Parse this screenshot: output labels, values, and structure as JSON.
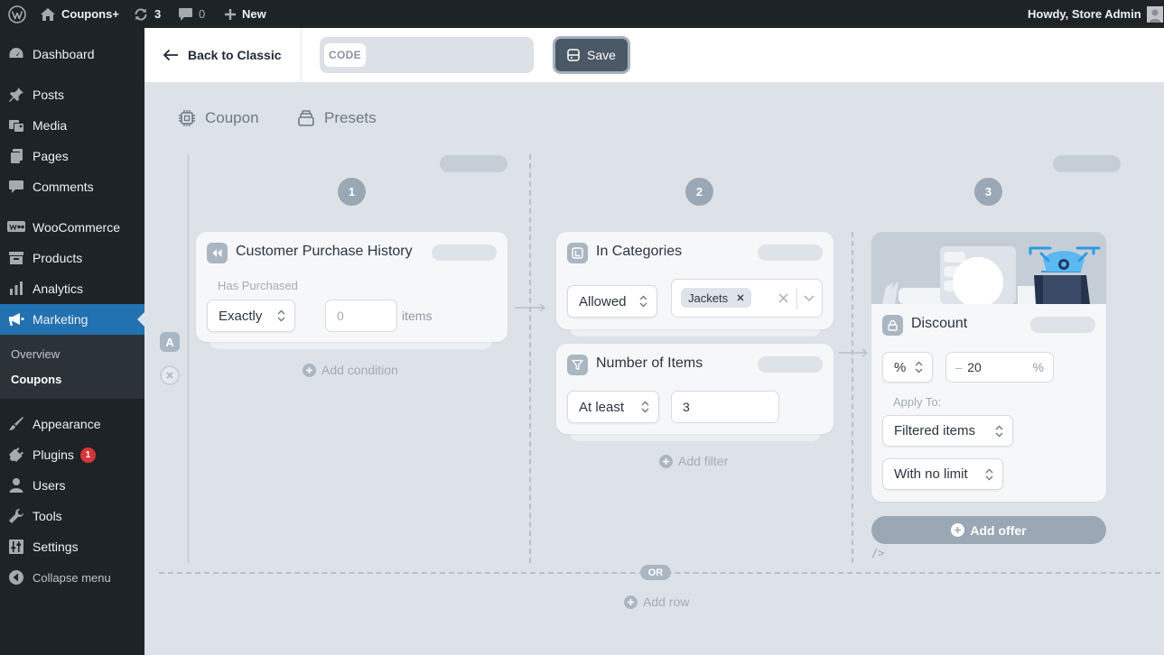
{
  "admin_bar": {
    "site_name": "Coupons+",
    "updates_count": "3",
    "comments_count": "0",
    "new_label": "New",
    "greeting": "Howdy, Store Admin"
  },
  "sidebar": {
    "items": [
      {
        "label": "Dashboard",
        "icon": "dashboard-icon"
      },
      {
        "label": "Posts",
        "icon": "pin-icon"
      },
      {
        "label": "Media",
        "icon": "media-icon"
      },
      {
        "label": "Pages",
        "icon": "pages-icon"
      },
      {
        "label": "Comments",
        "icon": "comment-icon"
      },
      {
        "label": "WooCommerce",
        "icon": "woo-icon"
      },
      {
        "label": "Products",
        "icon": "archive-icon"
      },
      {
        "label": "Analytics",
        "icon": "bar-chart-icon"
      },
      {
        "label": "Marketing",
        "icon": "megaphone-icon"
      },
      {
        "label": "Appearance",
        "icon": "brush-icon"
      },
      {
        "label": "Plugins",
        "icon": "plug-icon",
        "badge": "1"
      },
      {
        "label": "Users",
        "icon": "user-icon"
      },
      {
        "label": "Tools",
        "icon": "wrench-icon"
      },
      {
        "label": "Settings",
        "icon": "sliders-icon"
      },
      {
        "label": "Collapse menu",
        "icon": "collapse-icon"
      }
    ],
    "submenu": [
      {
        "label": "Overview"
      },
      {
        "label": "Coupons"
      }
    ]
  },
  "toolbar": {
    "back_label": "Back to Classic",
    "code_tag": "CODE",
    "code_value": "",
    "save_label": "Save"
  },
  "tabs": [
    {
      "label": "Coupon"
    },
    {
      "label": "Presets"
    }
  ],
  "columns": [
    "1",
    "2",
    "3"
  ],
  "row_marker": "A",
  "condition": {
    "title": "Customer Purchase History",
    "field_label": "Has Purchased",
    "operator": "Exactly",
    "value_placeholder": "0",
    "unit": "items",
    "add_label": "Add condition"
  },
  "filters": {
    "categories": {
      "title": "In Categories",
      "mode": "Allowed",
      "tag": "Jackets"
    },
    "items": {
      "title": "Number of Items",
      "operator": "At least",
      "value": "3"
    },
    "add_label": "Add filter"
  },
  "offer": {
    "title": "Discount",
    "type": "%",
    "sign": "–",
    "value": "20",
    "unit": "%",
    "apply_label": "Apply To:",
    "apply_value": "Filtered items",
    "limit_value": "With no limit",
    "add_label": "Add offer",
    "code_marker": "/>"
  },
  "or_label": "OR",
  "add_row_label": "Add row"
}
